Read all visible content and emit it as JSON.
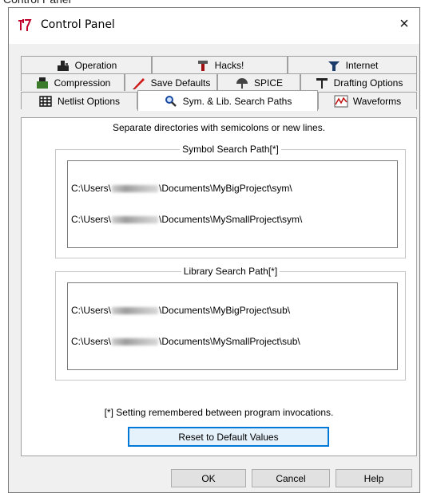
{
  "window": {
    "title": "Control Panel",
    "close_label": "×"
  },
  "tabs": {
    "row1": [
      "Operation",
      "Hacks!",
      "Internet"
    ],
    "row2": [
      "Compression",
      "Save Defaults",
      "SPICE",
      "Drafting Options"
    ],
    "row3": [
      "Netlist Options",
      "Sym. & Lib. Search Paths",
      "Waveforms"
    ],
    "active": "Sym. & Lib. Search Paths"
  },
  "page": {
    "hint": "Separate directories with semicolons or new lines.",
    "symbol_group_label": "Symbol Search Path[*]",
    "symbol_paths": [
      {
        "prefix": "C:\\Users\\",
        "suffix": "\\Documents\\MyBigProject\\sym\\"
      },
      {
        "prefix": "C:\\Users\\",
        "suffix": "\\Documents\\MySmallProject\\sym\\"
      }
    ],
    "library_group_label": "Library Search Path[*]",
    "library_paths": [
      {
        "prefix": "C:\\Users\\",
        "suffix": "\\Documents\\MyBigProject\\sub\\"
      },
      {
        "prefix": "C:\\Users\\",
        "suffix": "\\Documents\\MySmallProject\\sub\\"
      }
    ],
    "note": "[*] Setting remembered between program invocations.",
    "reset_label": "Reset to Default Values"
  },
  "buttons": {
    "ok": "OK",
    "cancel": "Cancel",
    "help": "Help"
  },
  "colors": {
    "accent": "#0078d7",
    "face": "#f0f0f0",
    "border": "#a0a0a0"
  }
}
